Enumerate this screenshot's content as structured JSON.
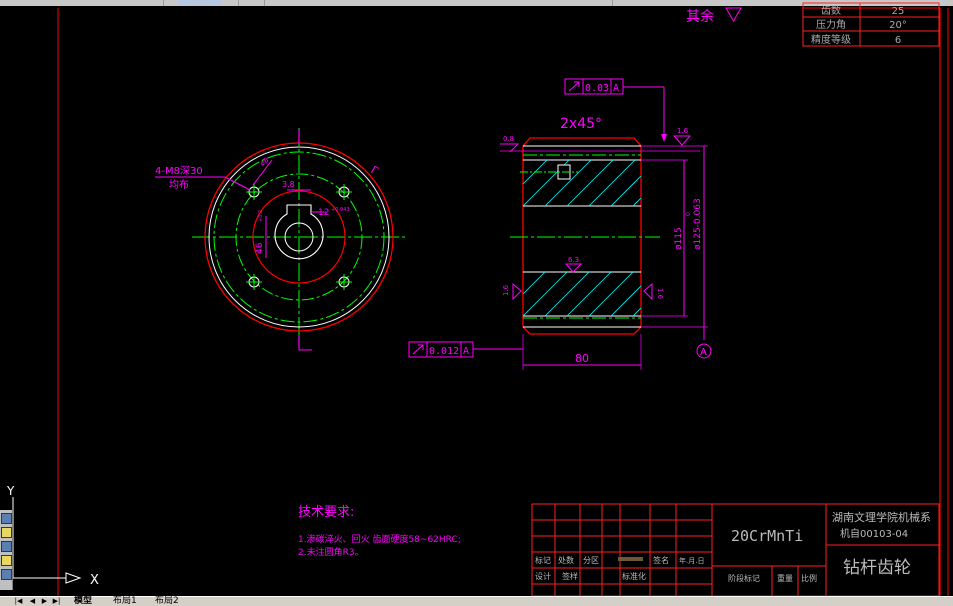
{
  "title_block": {
    "material": "20CrMnTi",
    "school_line1": "湖南文理学院机械系",
    "school_line2": "机自00103-04",
    "part_name": "钻杆齿轮",
    "row_labels_1": [
      "标记",
      "处数",
      "分区"
    ],
    "row_labels_1_right": [
      "签名",
      "年.月.日"
    ],
    "row_labels_2": [
      "设计",
      "签样",
      "标准化"
    ],
    "bottom_labels": [
      "阶段标记",
      "重量",
      "比例"
    ]
  },
  "gear_params": {
    "rows": [
      {
        "label": "齿数",
        "value": "25"
      },
      {
        "label": "压力角",
        "value": "20°"
      },
      {
        "label": "精度等级",
        "value": "6"
      }
    ]
  },
  "roughness_rest": "其余",
  "tech_requirements": {
    "heading": "技术要求:",
    "items": [
      "1.渗碳淬火、回火 齿面硬度58~62HRC;",
      "2.未注圆角R3。"
    ]
  },
  "left_view": {
    "hole_note_line1": "4-M8深30",
    "hole_note_line2": "均布",
    "dim_key_width": "12",
    "dim_key_tol": "+0.043",
    "dim_hub": "46",
    "dim_hub_tol": "+0.2",
    "dim_small": "3.8",
    "section_mark": "Γ"
  },
  "right_view": {
    "chamfer": "2x45°",
    "tol_top_value": "0.03",
    "tol_top_datum": "A",
    "tol_bottom_value": "0.012",
    "tol_bottom_datum": "A",
    "datum_label": "A",
    "dim_width": "80",
    "dim_dia_inner": "ø115",
    "dim_dia_outer": "ø125-0.063",
    "dim_dia_outer_upper": "0",
    "rough_top_left": "0.8",
    "rough_top_right": "1.6",
    "rough_mid": "6.3",
    "rough_left": "1.6",
    "rough_right": "1.6"
  },
  "ucs": {
    "x_label": "X",
    "y_label": "Y"
  },
  "tabs": [
    "模型",
    "布局1",
    "布局2"
  ],
  "colors": {
    "background": "#000000",
    "frame": "#ff0000",
    "dimension": "#ff00ff",
    "centerline": "#00ff00",
    "outline": "#ffffff",
    "hatch": "#00ffff",
    "titleblock": "#ff2020"
  }
}
